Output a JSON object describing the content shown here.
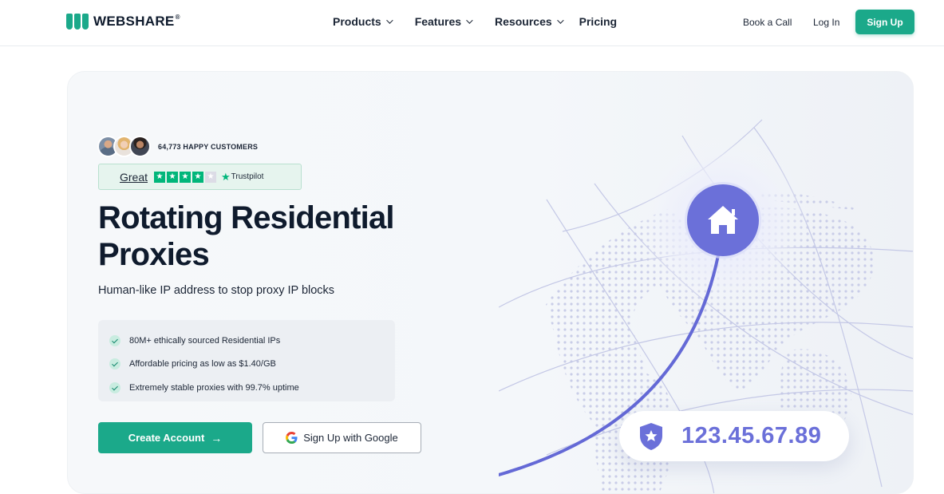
{
  "nav": {
    "brand": "WEBSHARE",
    "brand_mark": "®",
    "menu": [
      {
        "label": "Products",
        "has_dropdown": true
      },
      {
        "label": "Features",
        "has_dropdown": true
      },
      {
        "label": "Resources",
        "has_dropdown": true
      },
      {
        "label": "Pricing",
        "has_dropdown": false
      }
    ],
    "book_call": "Book a Call",
    "login": "Log In",
    "signup": "Sign Up"
  },
  "hero": {
    "customers": "64,773 HAPPY CUSTOMERS",
    "trust": {
      "word": "Great",
      "rating_stars": 4,
      "brand": "Trustpilot"
    },
    "title_line1": "Rotating Residential",
    "title_line2": "Proxies",
    "subtitle": "Human-like IP address to stop proxy IP blocks",
    "features": [
      "80M+ ethically sourced Residential IPs",
      "Affordable pricing as low as $1.40/GB",
      "Extremely stable proxies with 99.7% uptime"
    ],
    "create_account": "Create Account",
    "google_signup": "Sign Up with Google",
    "ip_address": "123.45.67.89"
  },
  "colors": {
    "brand_green": "#1ba98a",
    "accent_purple": "#6b70d9",
    "trustpilot_green": "#00b67a"
  },
  "icons": {
    "logo": "webshare-bars-icon",
    "home": "home-icon",
    "shield": "shield-star-icon",
    "google": "google-g-icon",
    "arrow": "arrow-right-icon"
  }
}
